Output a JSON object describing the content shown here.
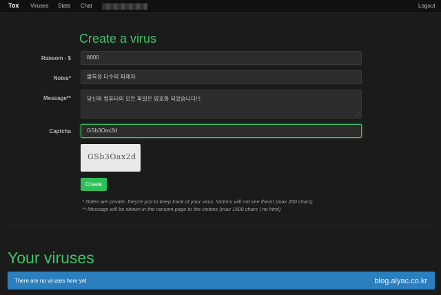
{
  "navbar": {
    "brand": "Tox",
    "links": [
      "Viruses",
      "Stats",
      "Chat"
    ],
    "logout": "Logout"
  },
  "form": {
    "title": "Create a virus",
    "ransom": {
      "label": "Ransom - $",
      "value": "8000"
    },
    "notes": {
      "label": "Notes*",
      "value": "불특정 다수의 피해자"
    },
    "message": {
      "label": "Message**",
      "value": "당신의 컴퓨터의 모든 파일은 암호화 되었습니다!!!"
    },
    "captcha": {
      "label": "Captcha",
      "value": "GSb3Oax2d",
      "image_text": "GSb3Oax2d"
    },
    "submit_label": "Create",
    "note1": "* Notes are private, they're just to keep track of your virus. Victims will not see them! (max 200 chars)",
    "note2": "** Message will be shown in the ransom page to the victims (max 1500 chars | no html)"
  },
  "viruses": {
    "title": "Your viruses",
    "empty_text": "There are no viruses here yet"
  },
  "watermark": "blog.alyac.co.kr"
}
